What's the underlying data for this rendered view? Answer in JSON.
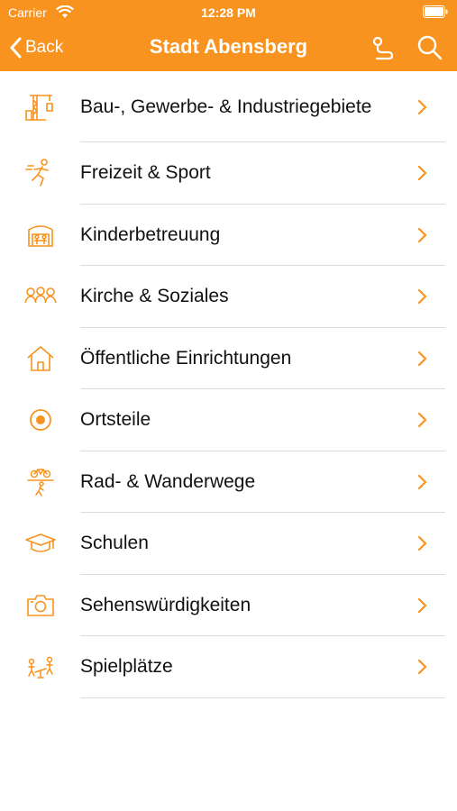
{
  "status": {
    "carrier": "Carrier",
    "time": "12:28 PM"
  },
  "nav": {
    "back_label": "Back",
    "title": "Stadt Abensberg"
  },
  "colors": {
    "accent": "#f7931e",
    "separator": "#dcdcdc"
  },
  "items": [
    {
      "label": "Bau-, Gewerbe- & Industriegebiete",
      "icon": "crane-icon"
    },
    {
      "label": "Freizeit & Sport",
      "icon": "running-icon"
    },
    {
      "label": "Kinderbetreuung",
      "icon": "kindergarten-icon"
    },
    {
      "label": "Kirche & Soziales",
      "icon": "people-icon"
    },
    {
      "label": "Öffentliche Einrichtungen",
      "icon": "house-icon"
    },
    {
      "label": "Ortsteile",
      "icon": "location-dot-icon"
    },
    {
      "label": "Rad- & Wanderwege",
      "icon": "bike-hike-icon"
    },
    {
      "label": "Schulen",
      "icon": "graduation-cap-icon"
    },
    {
      "label": "Sehenswürdigkeiten",
      "icon": "camera-icon"
    },
    {
      "label": "Spielplätze",
      "icon": "playground-icon"
    }
  ]
}
